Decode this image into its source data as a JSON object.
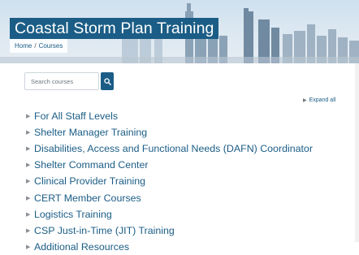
{
  "header": {
    "title": "Coastal Storm Plan Training",
    "breadcrumb": {
      "home": "Home",
      "separator": "/",
      "current": "Courses"
    }
  },
  "search": {
    "placeholder": "Search courses",
    "button_icon": "search-icon"
  },
  "expand_all_label": "Expand all",
  "courses": [
    {
      "label": "For All Staff Levels"
    },
    {
      "label": "Shelter Manager Training"
    },
    {
      "label": "Disabilities, Access and Functional Needs (DAFN) Coordinator"
    },
    {
      "label": "Shelter Command Center"
    },
    {
      "label": "Clinical Provider Training"
    },
    {
      "label": "CERT Member Courses"
    },
    {
      "label": "Logistics Training"
    },
    {
      "label": "CSP Just-in-Time (JIT) Training"
    },
    {
      "label": "Additional Resources"
    }
  ],
  "colors": {
    "primary": "#1b5d86",
    "banner_sky": "#cfe0ee",
    "caret": "#8a8f94"
  }
}
